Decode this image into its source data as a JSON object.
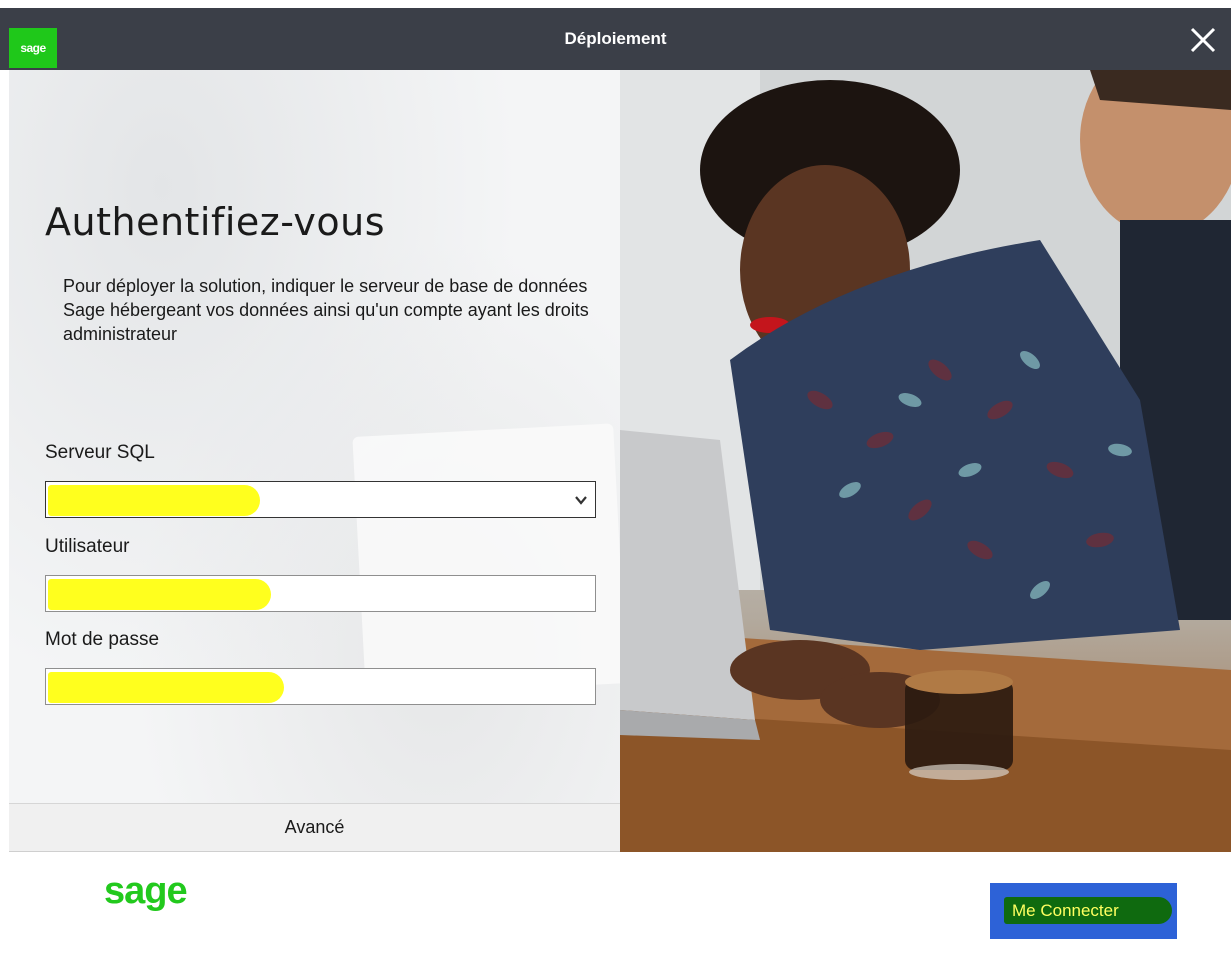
{
  "window": {
    "title": "Déploiement",
    "logo_text": "sage",
    "close_icon": "close-icon"
  },
  "auth": {
    "title": "Authentifiez-vous",
    "description": "Pour déployer la solution, indiquer le serveur de base de données Sage hébergeant vos données ainsi qu'un compte ayant les droits administrateur",
    "fields": [
      {
        "label": "Serveur SQL",
        "type": "select",
        "value": ""
      },
      {
        "label": "Utilisateur",
        "type": "text",
        "value": ""
      },
      {
        "label": "Mot de passe",
        "type": "password",
        "value": ""
      }
    ],
    "advanced_label": "Avancé"
  },
  "footer": {
    "brand": "sage",
    "connect_label": "Me Connecter"
  },
  "colors": {
    "titlebar": "#3b3f48",
    "brand_green": "#22c91d",
    "button_blue": "#2d62d7",
    "redaction_yellow": "#ffff1e"
  }
}
